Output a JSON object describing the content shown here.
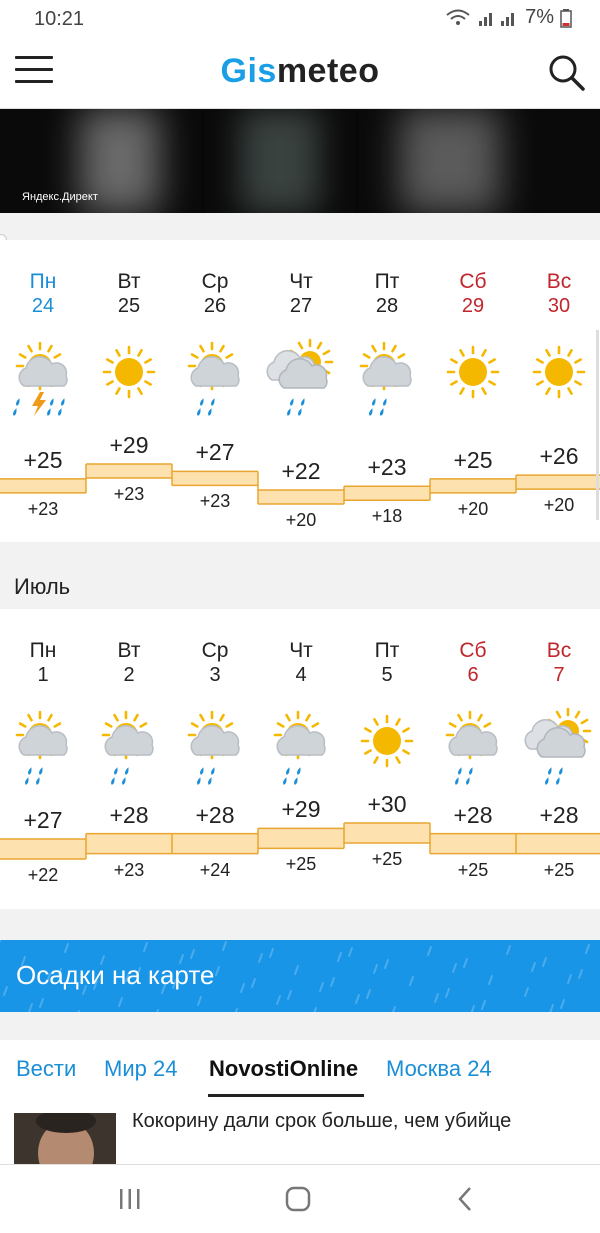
{
  "status": {
    "time": "10:21",
    "battery": "7%"
  },
  "app": {
    "logo_gis": "Gis",
    "logo_meteo": "meteo"
  },
  "ad": {
    "label": "Яндекс.Директ"
  },
  "week1": {
    "days": [
      {
        "name": "Пн",
        "date": "24",
        "kind": "today",
        "icon": "partly-cloudy-thunderstorm-icon",
        "max": "+25",
        "min": "+23",
        "max_value": 25
      },
      {
        "name": "Вт",
        "date": "25",
        "kind": "weekday",
        "icon": "sunny-icon",
        "max": "+29",
        "min": "+23",
        "max_value": 29
      },
      {
        "name": "Ср",
        "date": "26",
        "kind": "weekday",
        "icon": "partly-cloudy-rain-icon",
        "max": "+27",
        "min": "+23",
        "max_value": 27
      },
      {
        "name": "Чт",
        "date": "27",
        "kind": "weekday",
        "icon": "cloudy-rain-icon",
        "max": "+22",
        "min": "+20",
        "max_value": 22
      },
      {
        "name": "Пт",
        "date": "28",
        "kind": "weekday",
        "icon": "partly-cloudy-rain-icon",
        "max": "+23",
        "min": "+18",
        "max_value": 23
      },
      {
        "name": "Сб",
        "date": "29",
        "kind": "weekend",
        "icon": "sunny-icon",
        "max": "+25",
        "min": "+20",
        "max_value": 25
      },
      {
        "name": "Вс",
        "date": "30",
        "kind": "weekend",
        "icon": "sunny-icon",
        "max": "+26",
        "min": "+20",
        "max_value": 26
      }
    ]
  },
  "month_label": "Июль",
  "week2": {
    "days": [
      {
        "name": "Пн",
        "date": "1",
        "kind": "weekday",
        "icon": "partly-cloudy-rain-icon",
        "max": "+27",
        "min": "+22",
        "max_value": 27
      },
      {
        "name": "Вт",
        "date": "2",
        "kind": "weekday",
        "icon": "partly-cloudy-rain-icon",
        "max": "+28",
        "min": "+23",
        "max_value": 28
      },
      {
        "name": "Ср",
        "date": "3",
        "kind": "weekday",
        "icon": "partly-cloudy-rain-icon",
        "max": "+28",
        "min": "+24",
        "max_value": 28
      },
      {
        "name": "Чт",
        "date": "4",
        "kind": "weekday",
        "icon": "partly-cloudy-rain-icon",
        "max": "+29",
        "min": "+25",
        "max_value": 29
      },
      {
        "name": "Пт",
        "date": "5",
        "kind": "weekday",
        "icon": "sunny-icon",
        "max": "+30",
        "min": "+25",
        "max_value": 30
      },
      {
        "name": "Сб",
        "date": "6",
        "kind": "weekend",
        "icon": "partly-cloudy-rain-icon",
        "max": "+28",
        "min": "+25",
        "max_value": 28
      },
      {
        "name": "Вс",
        "date": "7",
        "kind": "weekend",
        "icon": "cloudy-rain-icon",
        "max": "+28",
        "min": "+25",
        "max_value": 28
      }
    ]
  },
  "promo": {
    "text": "Осадки на карте"
  },
  "news": {
    "tabs": [
      {
        "label": "Вести",
        "active": false
      },
      {
        "label": "Мир 24",
        "active": false
      },
      {
        "label": "NovostiOnline",
        "active": true
      },
      {
        "label": "Москва 24",
        "active": false
      }
    ],
    "headline": "Кокорину дали срок больше, чем убийце"
  },
  "colors": {
    "accent": "#1a9ee6",
    "weekend": "#c0262b",
    "today": "#1a8ed6",
    "band_fill": "#fde2b0",
    "band_line": "#e8a530",
    "sun": "#f5b800"
  }
}
